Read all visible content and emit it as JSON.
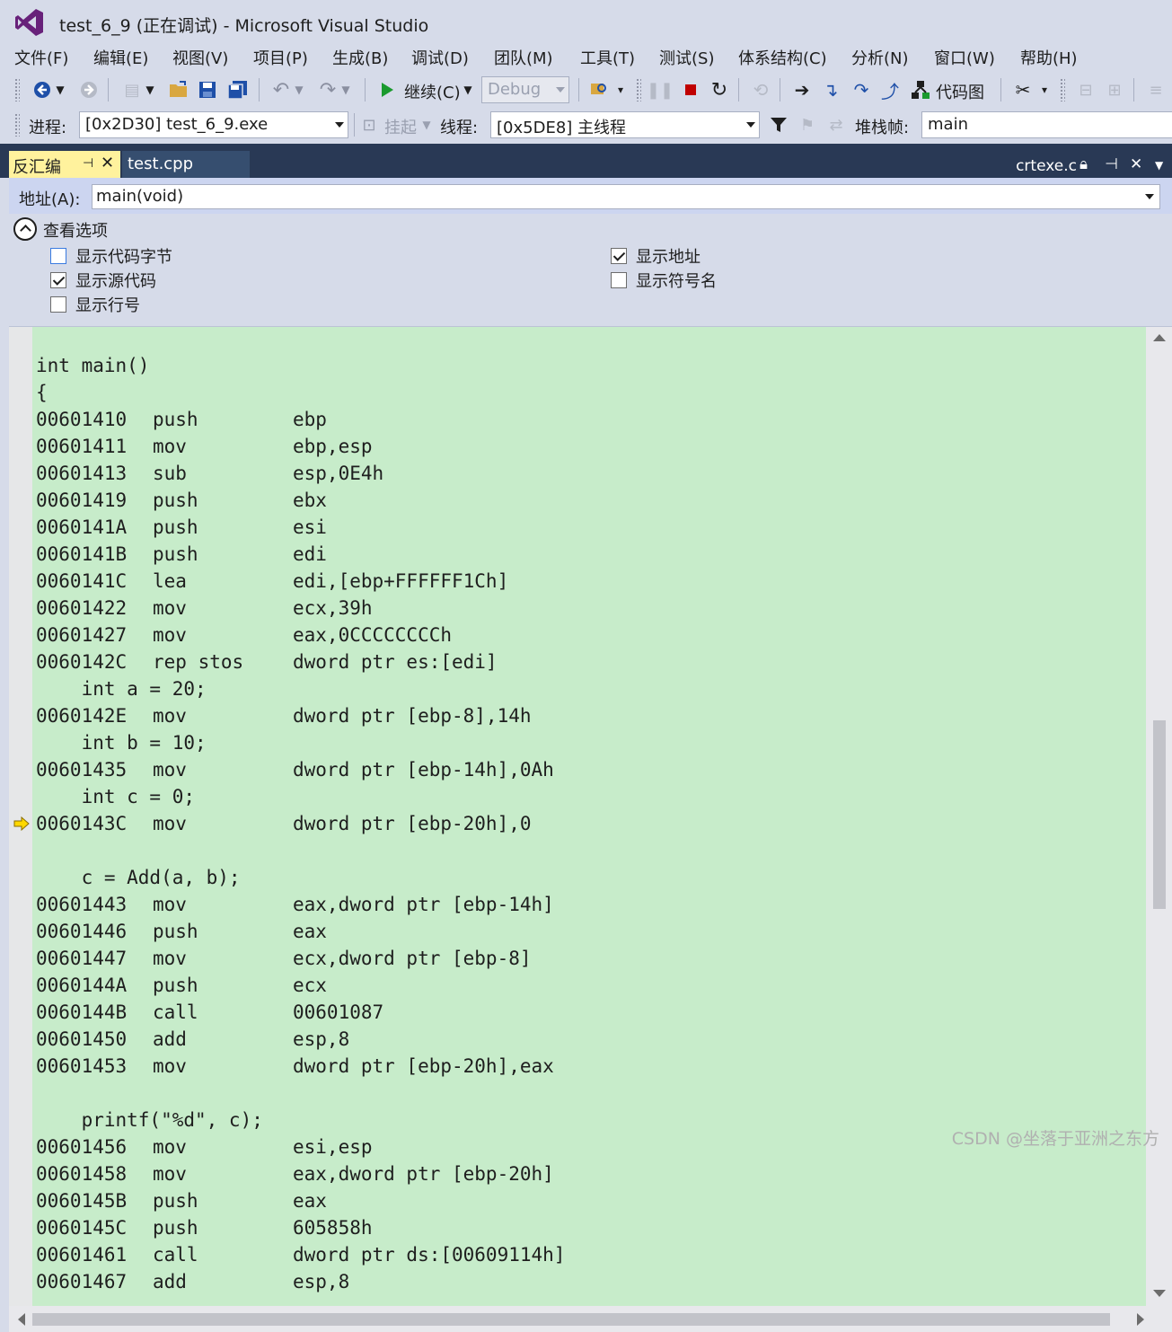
{
  "window": {
    "title": "test_6_9 (正在调试) - Microsoft Visual Studio"
  },
  "menu": [
    "文件(F)",
    "编辑(E)",
    "视图(V)",
    "项目(P)",
    "生成(B)",
    "调试(D)",
    "团队(M)",
    "工具(T)",
    "测试(S)",
    "体系结构(C)",
    "分析(N)",
    "窗口(W)",
    "帮助(H)"
  ],
  "toolbar1": {
    "continue_label": "继续(C)",
    "config_value": "Debug",
    "codemap_label": "代码图"
  },
  "toolbar2": {
    "process_label": "进程:",
    "process_value": "[0x2D30] test_6_9.exe",
    "suspend_label": "挂起",
    "thread_label": "线程:",
    "thread_value": "[0x5DE8] 主线程",
    "stackframe_label": "堆栈帧:",
    "stackframe_value": "main"
  },
  "tabs": {
    "active": "反汇编",
    "inactive": "test.cpp",
    "right_file": "crtexe.c"
  },
  "address": {
    "label": "地址(A):",
    "value": "main(void)"
  },
  "view_options": {
    "title": "查看选项",
    "show_code_bytes": "显示代码字节",
    "show_source": "显示源代码",
    "show_line_numbers": "显示行号",
    "show_address": "显示地址",
    "show_symbol_names": "显示符号名",
    "checked": {
      "show_code_bytes": false,
      "show_source": true,
      "show_line_numbers": false,
      "show_address": true,
      "show_symbol_names": false
    }
  },
  "code_lines": [
    {
      "src": "int main()"
    },
    {
      "src": "{"
    },
    {
      "addr": "00601410",
      "op": "push",
      "arg": "ebp"
    },
    {
      "addr": "00601411",
      "op": "mov",
      "arg": "ebp,esp"
    },
    {
      "addr": "00601413",
      "op": "sub",
      "arg": "esp,0E4h"
    },
    {
      "addr": "00601419",
      "op": "push",
      "arg": "ebx"
    },
    {
      "addr": "0060141A",
      "op": "push",
      "arg": "esi"
    },
    {
      "addr": "0060141B",
      "op": "push",
      "arg": "edi"
    },
    {
      "addr": "0060141C",
      "op": "lea",
      "arg": "edi,[ebp+FFFFFF1Ch]"
    },
    {
      "addr": "00601422",
      "op": "mov",
      "arg": "ecx,39h"
    },
    {
      "addr": "00601427",
      "op": "mov",
      "arg": "eax,0CCCCCCCCh"
    },
    {
      "addr": "0060142C",
      "op": "rep stos",
      "arg": "dword ptr es:[edi]"
    },
    {
      "src": "    int a = 20;"
    },
    {
      "addr": "0060142E",
      "op": "mov",
      "arg": "dword ptr [ebp-8],14h"
    },
    {
      "src": "    int b = 10;"
    },
    {
      "addr": "00601435",
      "op": "mov",
      "arg": "dword ptr [ebp-14h],0Ah"
    },
    {
      "src": "    int c = 0;"
    },
    {
      "addr": "0060143C",
      "op": "mov",
      "arg": "dword ptr [ebp-20h],0"
    },
    {
      "src": ""
    },
    {
      "src": "    c = Add(a, b);"
    },
    {
      "addr": "00601443",
      "op": "mov",
      "arg": "eax,dword ptr [ebp-14h]"
    },
    {
      "addr": "00601446",
      "op": "push",
      "arg": "eax"
    },
    {
      "addr": "00601447",
      "op": "mov",
      "arg": "ecx,dword ptr [ebp-8]"
    },
    {
      "addr": "0060144A",
      "op": "push",
      "arg": "ecx"
    },
    {
      "addr": "0060144B",
      "op": "call",
      "arg": "00601087"
    },
    {
      "addr": "00601450",
      "op": "add",
      "arg": "esp,8"
    },
    {
      "addr": "00601453",
      "op": "mov",
      "arg": "dword ptr [ebp-20h],eax"
    },
    {
      "src": ""
    },
    {
      "src": "    printf(\"%d\", c);"
    },
    {
      "addr": "00601456",
      "op": "mov",
      "arg": "esi,esp"
    },
    {
      "addr": "00601458",
      "op": "mov",
      "arg": "eax,dword ptr [ebp-20h]"
    },
    {
      "addr": "0060145B",
      "op": "push",
      "arg": "eax"
    },
    {
      "addr": "0060145C",
      "op": "push",
      "arg": "605858h"
    },
    {
      "addr": "00601461",
      "op": "call",
      "arg": "dword ptr ds:[00609114h]"
    },
    {
      "addr": "00601467",
      "op": "add",
      "arg": "esp,8"
    }
  ],
  "current_instruction": "0060143C",
  "watermark": "CSDN @坐落于亚洲之东方",
  "colors": {
    "code_background": "#c7ecca",
    "active_tab": "#fff29d",
    "tab_strip": "#293955",
    "breakpoint_stop": "#c00000",
    "continue_green": "#1a9a2e"
  }
}
